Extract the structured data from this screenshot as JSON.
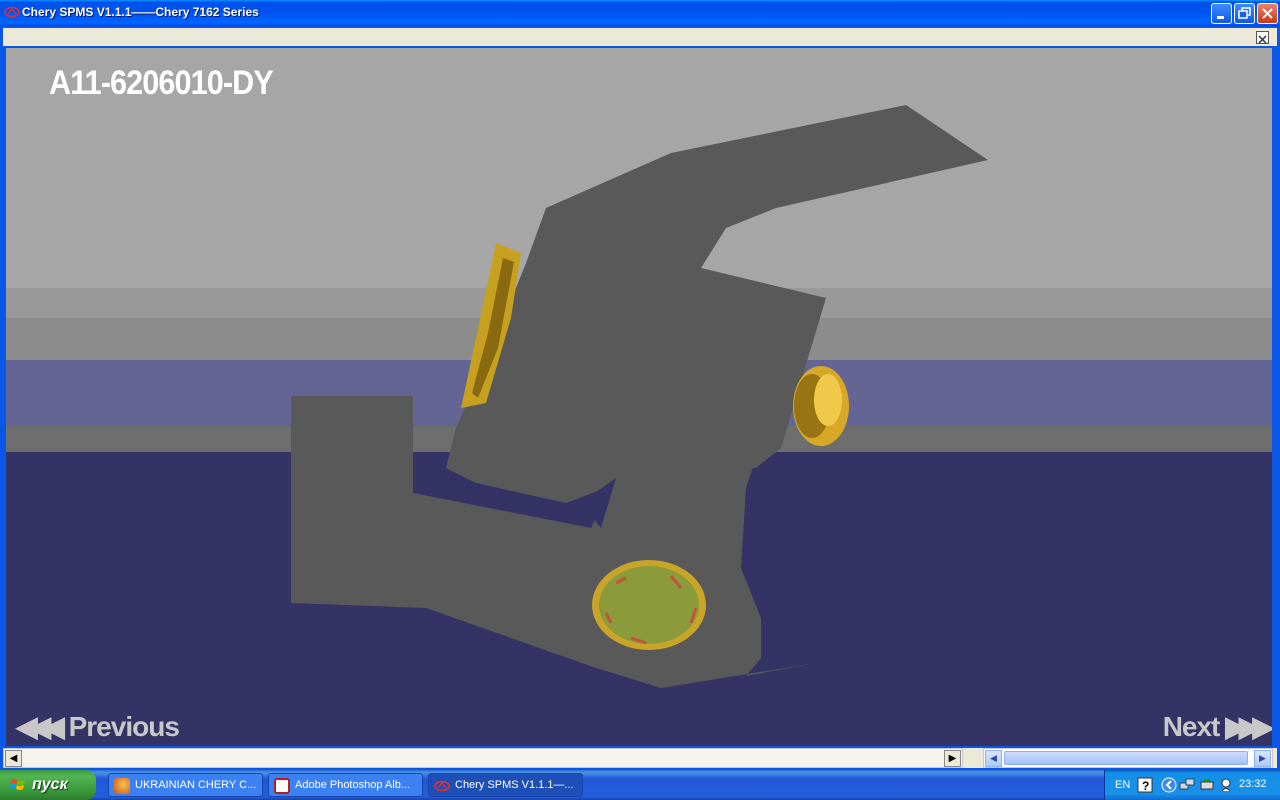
{
  "window": {
    "title": "Chery SPMS V1.1.1——Chery 7162 Series"
  },
  "viewer": {
    "part_code": "A11-6206010-DY",
    "prev_label": "Previous",
    "next_label": "Next"
  },
  "colors": {
    "part_gray": "#5a5a5a",
    "bolt_gold": "#e0b020",
    "floor": "#353266",
    "sky": "#a6a6a6"
  },
  "taskbar": {
    "start_label": "пуск",
    "tasks": [
      {
        "label": "UKRAINIAN CHERY C...",
        "icon": "firefox-icon"
      },
      {
        "label": "Adobe Photoshop Alb...",
        "icon": "photoshop-album-icon"
      },
      {
        "label": "Chery SPMS V1.1.1—...",
        "icon": "chery-logo-icon"
      }
    ],
    "tray": {
      "language": "EN",
      "time": "23:32"
    }
  }
}
